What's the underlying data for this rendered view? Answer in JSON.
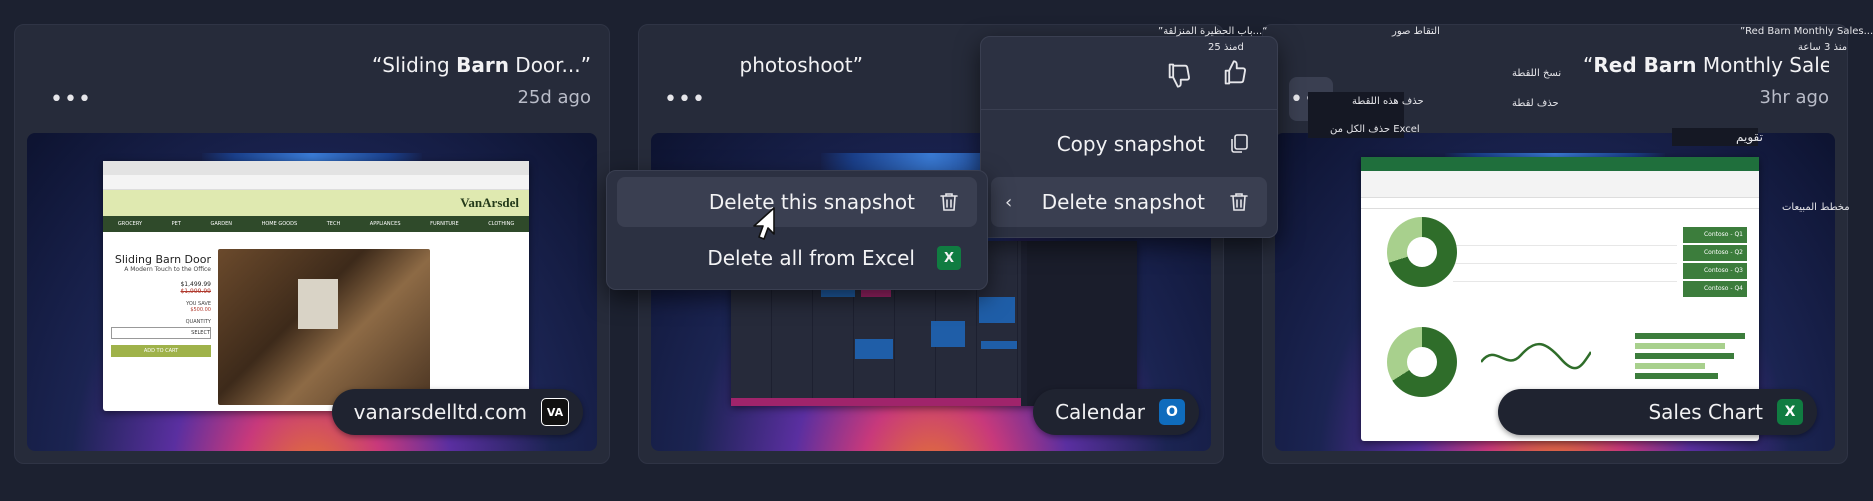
{
  "cards": [
    {
      "title_prefix": "“Sliding ",
      "title_bold": "Barn",
      "title_suffix": " Door...”",
      "time": "25d ago",
      "app_label": "vanarsdelltd.com",
      "app_icon_text": "VA",
      "app_icon_color": "#111111",
      "site": {
        "logo": "VanArsdel",
        "nav": [
          "CLOTHING",
          "FURNITURE",
          "APPLIANCES",
          "TECH",
          "HOME GOODS",
          "GARDEN",
          "PET",
          "GROCERY"
        ],
        "product_title": "Sliding Barn Door",
        "product_subtitle": "A Modern Touch to the Office",
        "price": "$1,499.99",
        "old_price": "$1,999.99",
        "you_save_label": "YOU SAVE",
        "you_save_value": "$500.00",
        "quantity_label": "QUANTITY",
        "select_label": "SELECT",
        "add_to_cart": "ADD TO CART"
      }
    },
    {
      "title": "photoshoot”",
      "app_label": "Calendar",
      "app_icon_text": "O",
      "app_icon_color": "#0f6cbd"
    },
    {
      "title_prefix": "“",
      "title_bold": "Red Barn",
      "title_suffix": " Monthly Sales...”",
      "time": "3hr ago",
      "app_label": "Sales Chart",
      "app_icon_text": "X",
      "app_icon_color": "#107c41",
      "sheet_rows": [
        "Contoso - Q1",
        "Contoso - Q2",
        "Contoso - Q3",
        "Contoso - Q4"
      ]
    }
  ],
  "submenu": {
    "items": [
      {
        "label": "Delete this snapshot"
      },
      {
        "label": "Delete all from Excel"
      }
    ]
  },
  "menu": {
    "items": [
      {
        "label": "Copy snapshot"
      },
      {
        "label": "Delete snapshot"
      }
    ]
  },
  "overlay_text": {
    "top_left_quote": "”باب الحظيرة المنزلقة...“",
    "top_left_time": "منذ 25d",
    "top_right_quote": "”Red Barn Monthly Sales...“",
    "top_right_time": "منذ 3 ساعة",
    "capture": "التقاط صور",
    "copy_snapshot": "نسخ اللقطة",
    "delete_snapshot": "حذف لقطة",
    "delete_this": "حذف هذه اللقطة",
    "delete_all": "حذف الكل من Excel",
    "calendar": "تقويم",
    "sales_chart": "مخطط المبيعات"
  }
}
